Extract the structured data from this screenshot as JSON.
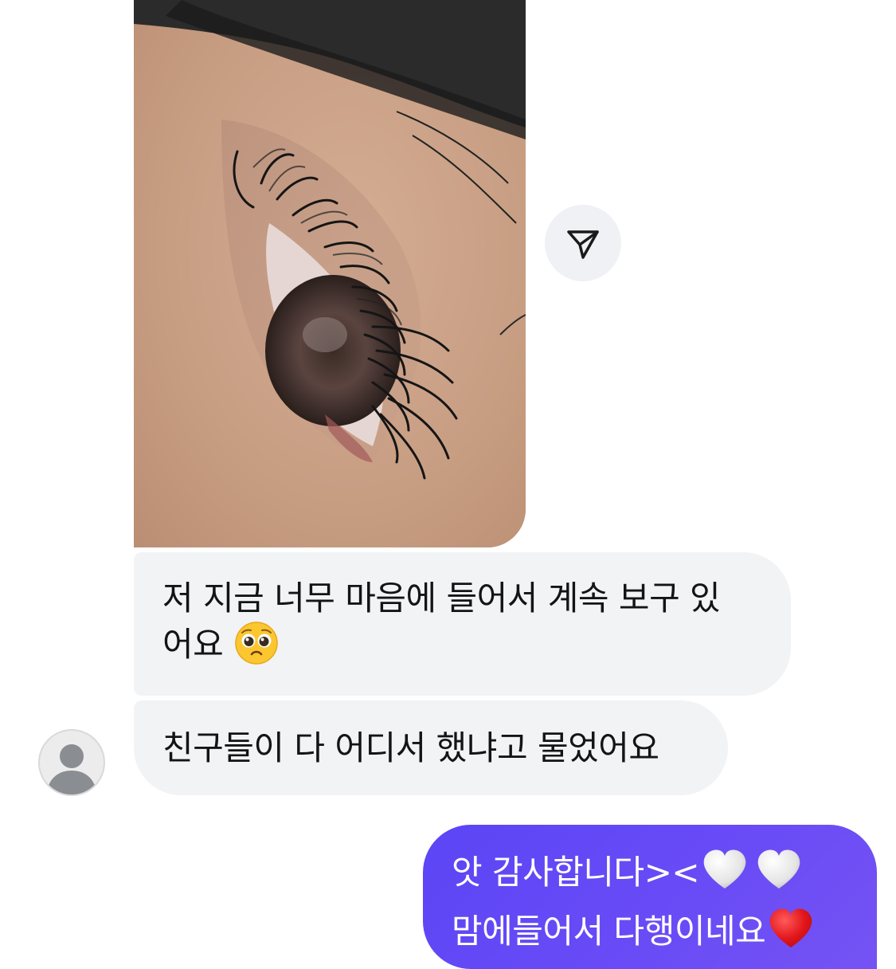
{
  "photo_message": {
    "image": "eyelash-extension-close-up-photo"
  },
  "share_button": {
    "icon": "paper-plane-icon"
  },
  "incoming_messages": [
    {
      "text_line1": "저 지금 너무 마음에 들어서 계속 보구 있",
      "text_line2": "어요",
      "emoji": "pleading-face-emoji"
    },
    {
      "text": "친구들이 다 어디서 했냐고 물었어요"
    }
  ],
  "avatar": {
    "icon": "default-user-avatar-icon"
  },
  "outgoing_message": {
    "line1": "앗 감사합니다><",
    "line1_emojis": [
      "white-heart-emoji",
      "white-heart-emoji"
    ],
    "line2": "맘에들어서 다행이네요",
    "line2_emoji": "red-heart-emoji"
  },
  "colors": {
    "incoming_bubble": "#f2f3f5",
    "outgoing_bubble": "#5b45f5",
    "share_button_bg": "#f0f1f4"
  }
}
